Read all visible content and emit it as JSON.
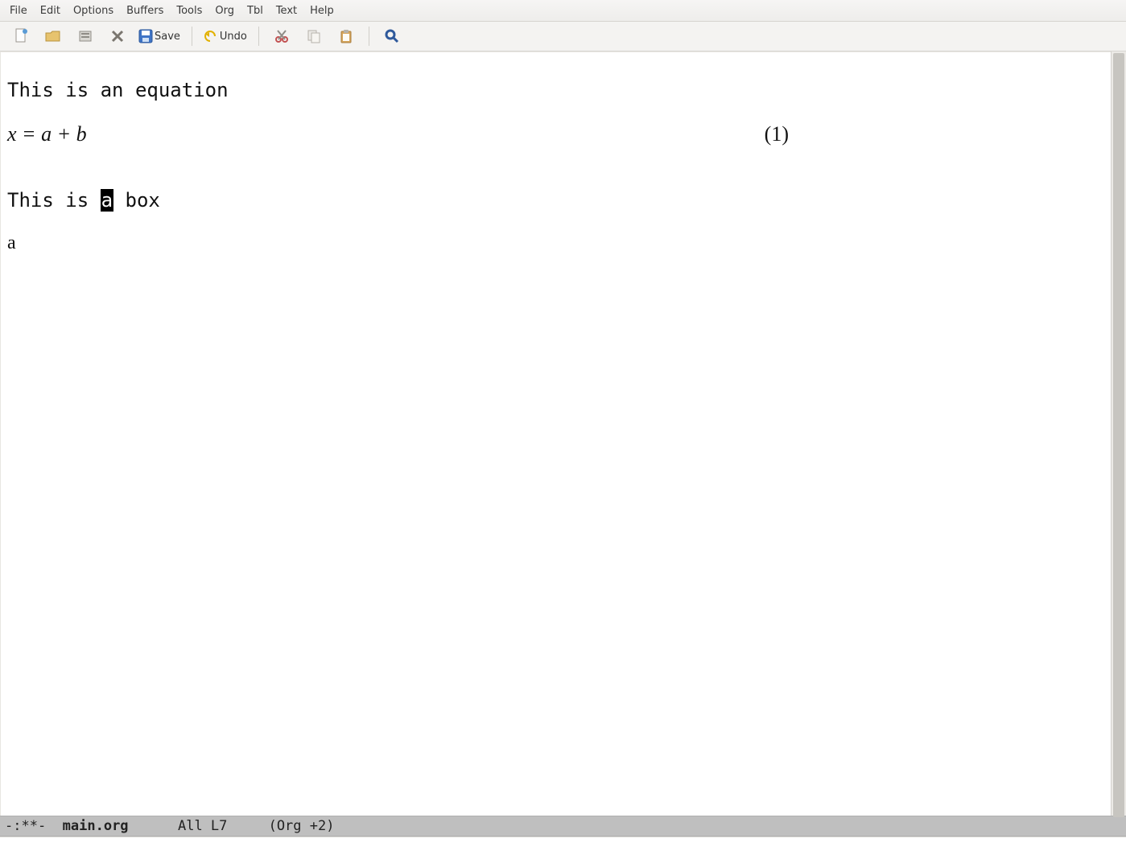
{
  "menubar": {
    "items": [
      "File",
      "Edit",
      "Options",
      "Buffers",
      "Tools",
      "Org",
      "Tbl",
      "Text",
      "Help"
    ]
  },
  "toolbar": {
    "save_label": "Save",
    "undo_label": "Undo"
  },
  "buffer": {
    "line1": "This is an equation",
    "equation_text": "x = a + b",
    "equation_number": "(1)",
    "line3_pre": "This is ",
    "line3_cursor": "a",
    "line3_post": " box",
    "line5": "a"
  },
  "modeline": {
    "status_prefix": "-:**-  ",
    "buffer_name": "main.org",
    "spacer1": "      ",
    "position": "All L7",
    "spacer2": "     ",
    "modes": "(Org +2)"
  }
}
